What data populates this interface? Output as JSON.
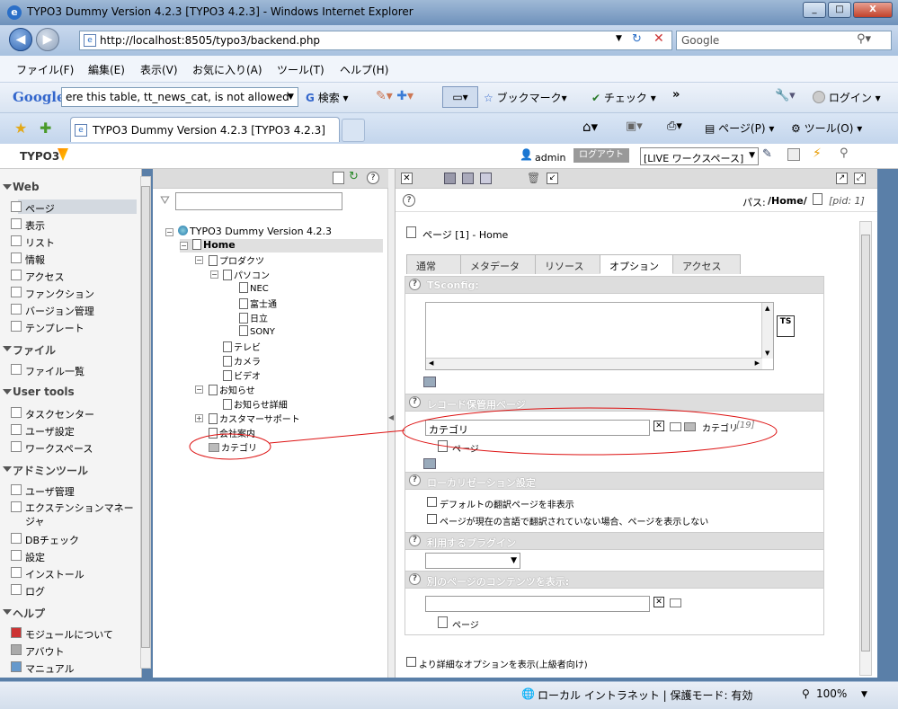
{
  "window": {
    "title": "TYPO3 Dummy Version 4.2.3 [TYPO3 4.2.3] - Windows Internet Explorer",
    "buttons": [
      "_",
      "□",
      "X"
    ]
  },
  "address": {
    "url": "http://localhost:8505/typo3/backend.php",
    "search_placeholder": "Google"
  },
  "menu": [
    "ファイル(F)",
    "編集(E)",
    "表示(V)",
    "お気に入り(A)",
    "ツール(T)",
    "ヘルプ(H)"
  ],
  "google_bar": {
    "logo": "Google",
    "query": "ere this table, tt_news_cat, is not allowed",
    "search": "検索",
    "bookmarks": "ブックマーク",
    "check": "チェック",
    "login": "ログイン"
  },
  "tab": {
    "title": "TYPO3 Dummy Version 4.2.3 [TYPO3 4.2.3]"
  },
  "tab_tools": {
    "page": "ページ(P)",
    "tools": "ツール(O)"
  },
  "typo3": {
    "logo": "TYPO3",
    "user": "admin",
    "logout": "ログアウト",
    "workspace": "[LIVE ワークスペース]"
  },
  "modules": {
    "web": {
      "label": "Web",
      "items": [
        "ページ",
        "表示",
        "リスト",
        "情報",
        "アクセス",
        "ファンクション",
        "バージョン管理",
        "テンプレート"
      ]
    },
    "file": {
      "label": "ファイル",
      "items": [
        "ファイル一覧"
      ]
    },
    "user": {
      "label": "User tools",
      "items": [
        "タスクセンター",
        "ユーザ設定",
        "ワークスペース"
      ]
    },
    "admin": {
      "label": "アドミンツール",
      "items": [
        "ユーザ管理",
        "エクステンションマネージャ",
        "DBチェック",
        "設定",
        "インストール",
        "ログ"
      ]
    },
    "help": {
      "label": "ヘルプ",
      "items": [
        "モジュールについて",
        "アバウト",
        "マニュアル"
      ]
    }
  },
  "tree": {
    "root": "TYPO3 Dummy Version 4.2.3",
    "home": "Home",
    "products": "プロダクツ",
    "pc": "パソコン",
    "nec": "NEC",
    "fujitsu": "富士通",
    "hitachi": "日立",
    "sony": "SONY",
    "tv": "テレビ",
    "camera": "カメラ",
    "video": "ビデオ",
    "news": "お知らせ",
    "news_detail": "お知らせ詳細",
    "support": "カスタマーサポート",
    "company": "会社案内",
    "category": "カテゴリ"
  },
  "content": {
    "path_label": "パス:",
    "path_value": "/Home/",
    "pid": "[pid: 1]",
    "page_title": "ページ [1] - Home",
    "tabs": [
      "通常",
      "メタデータ",
      "リソース",
      "オプション",
      "アクセス"
    ],
    "sections": {
      "tsconfig": "TSconfig:",
      "storage": "レコード保管用ページ",
      "localization": "ローカリゼーション設定",
      "plugin": "利用するプラグイン",
      "other_content": "別のページのコンテンツを表示:"
    },
    "ts_button": "TS",
    "storage_value": "カテゴリ",
    "storage_ref": "カテゴリ",
    "storage_ref_id": "[19]",
    "page_label": "ページ",
    "hide_default_translation": "デフォルトの翻訳ページを非表示",
    "hide_if_no_translation": "ページが現在の言語で翻訳されていない場合、ページを表示しない",
    "advanced": "より詳細なオプションを表示(上級者向け)"
  },
  "status": {
    "zone": "ローカル イントラネット | 保護モード: 有効",
    "zoom": "100%"
  }
}
